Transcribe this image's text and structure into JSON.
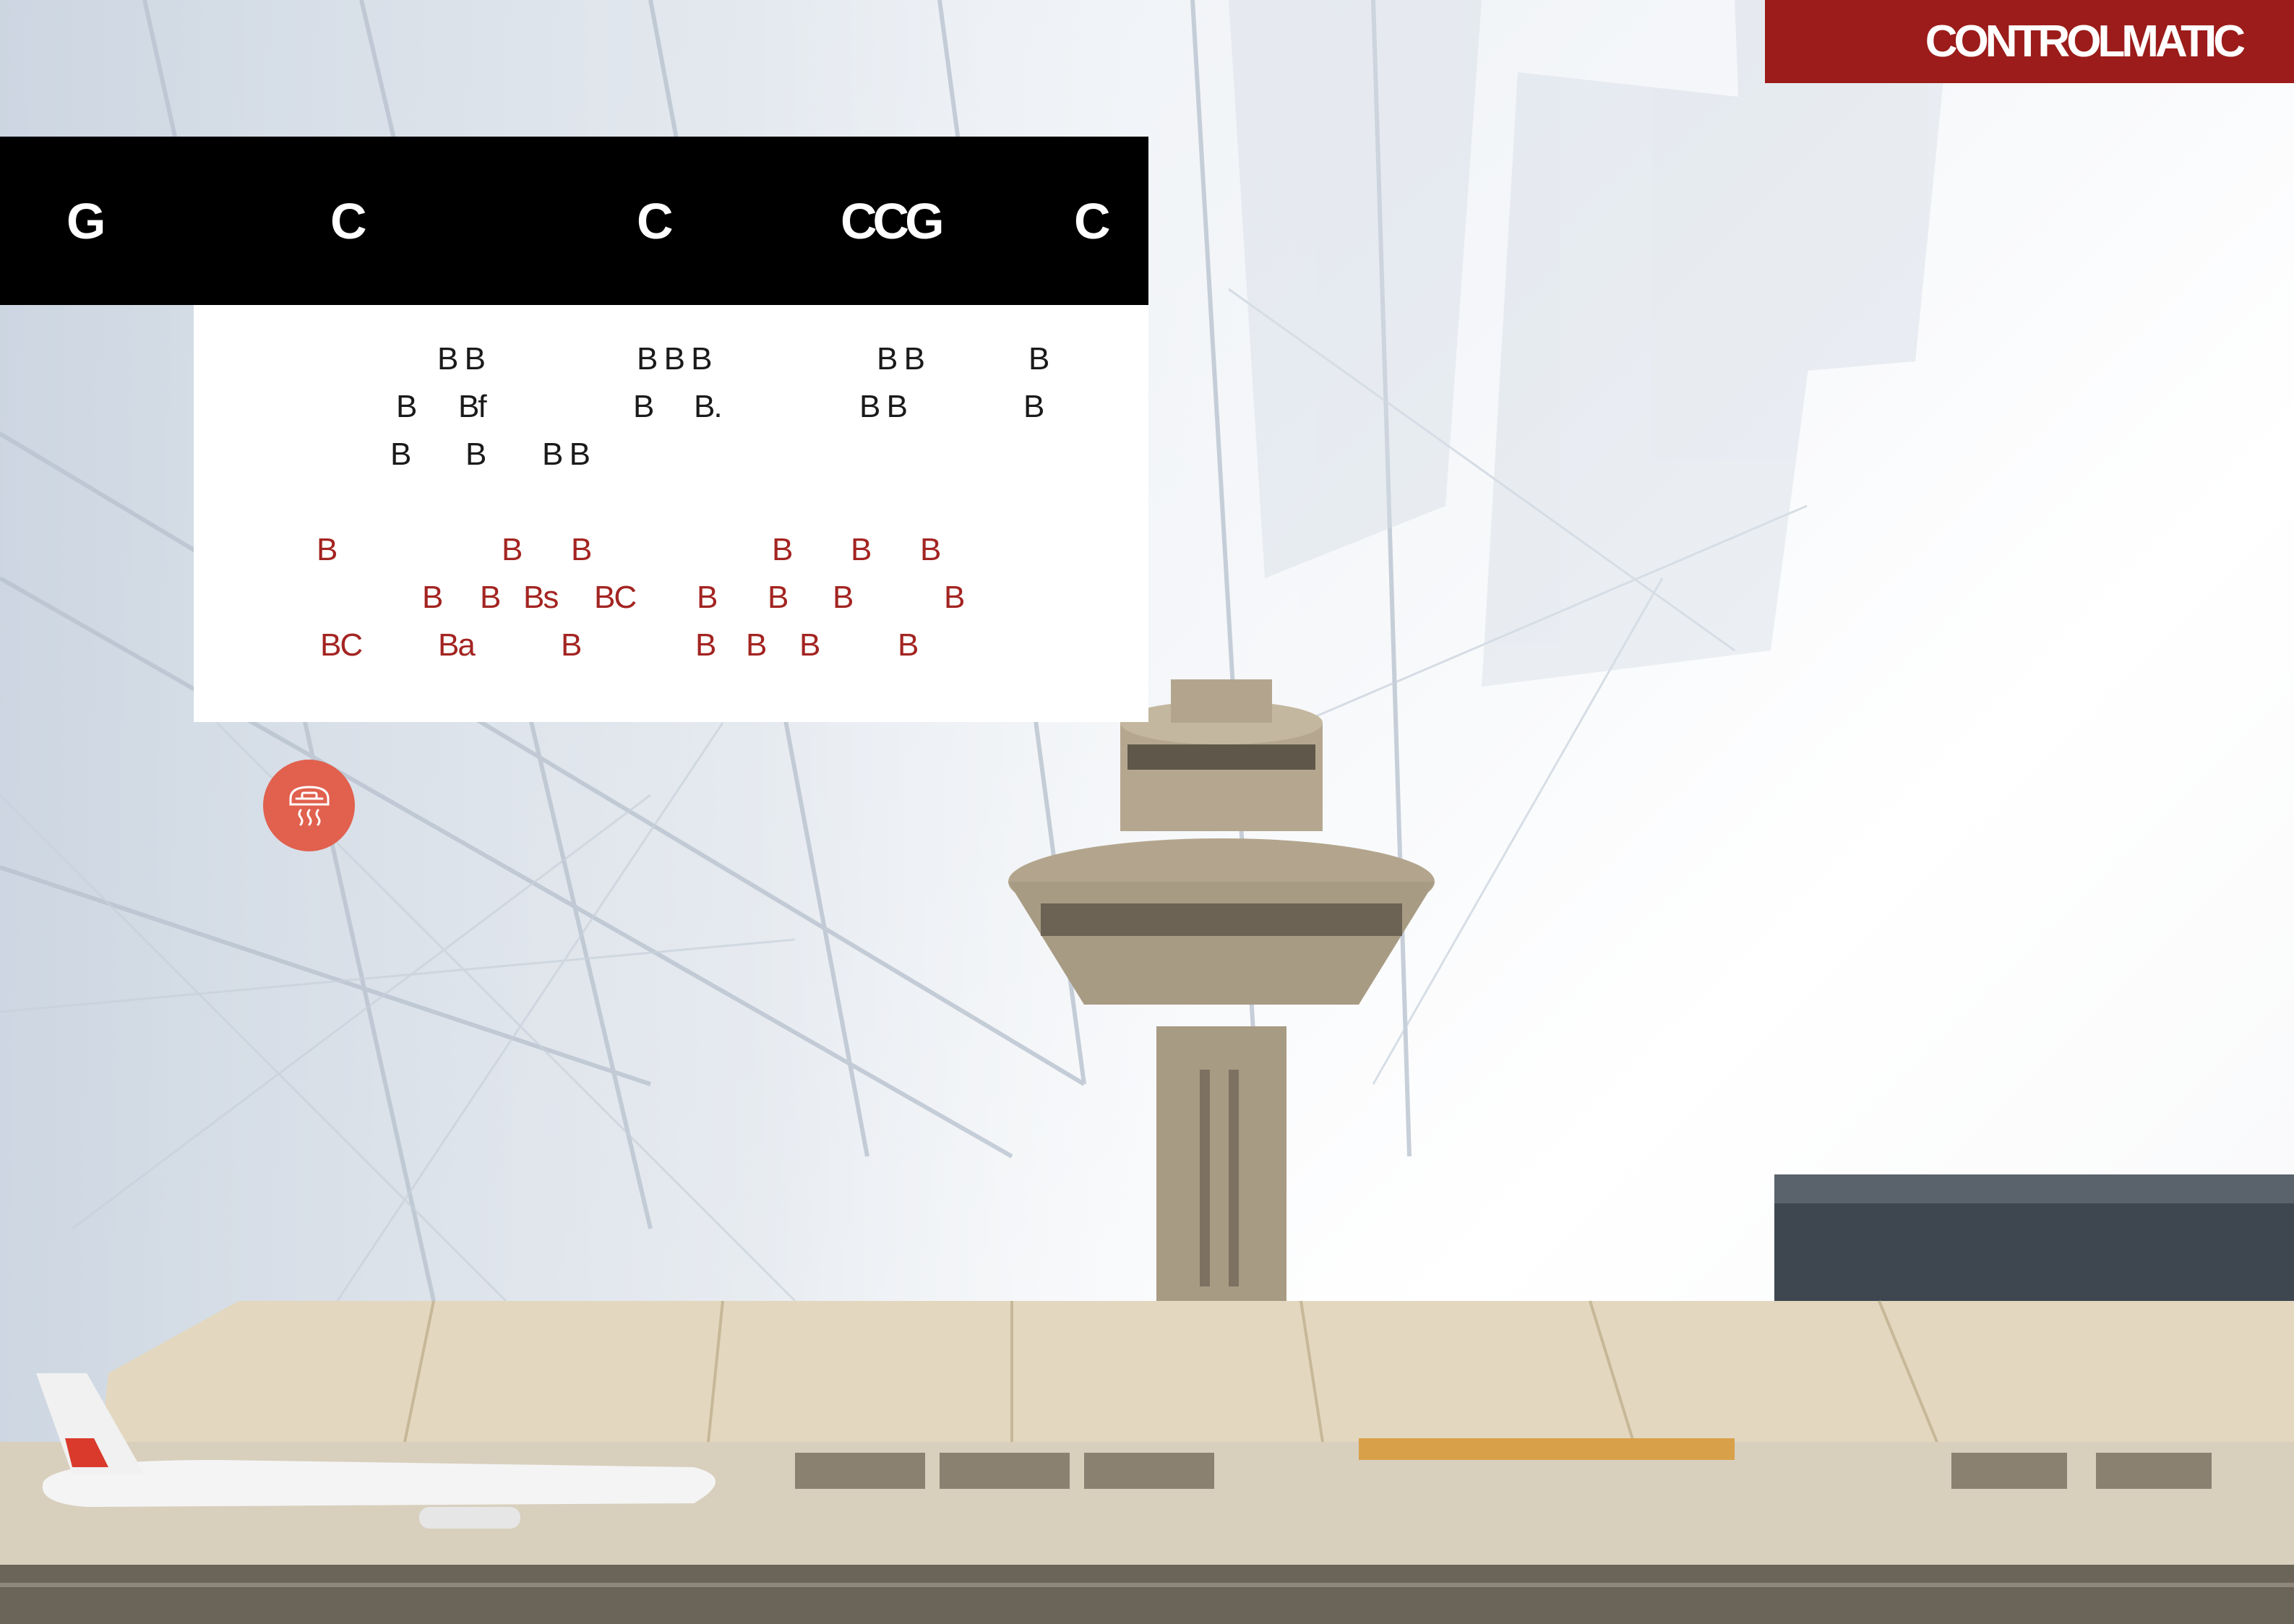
{
  "brand": {
    "name": "CONTROLMATIC"
  },
  "header": {
    "columns": [
      "G",
      "C",
      "C",
      "CCG",
      "C"
    ]
  },
  "body_text": {
    "black_rows": [
      [
        "B B",
        "B B B",
        "B B",
        "B"
      ],
      [
        "B",
        "Bf",
        "B",
        "B.",
        "B B",
        "B"
      ],
      [
        "B",
        "B",
        "B B"
      ]
    ],
    "red_rows": [
      [
        "B",
        "B",
        "B",
        "B",
        "B",
        "B"
      ],
      [
        "B",
        "B",
        "Bs",
        "BC",
        "B",
        "B",
        "B",
        "B"
      ],
      [
        "BC",
        "Ba",
        "B",
        "B",
        "B",
        "B",
        "B"
      ]
    ]
  },
  "icon": {
    "name": "heater-icon"
  },
  "colors": {
    "brand_red": "#9b1c1a",
    "header_black": "#000000",
    "text_red": "#a32421",
    "icon_circle": "#e1604e"
  }
}
